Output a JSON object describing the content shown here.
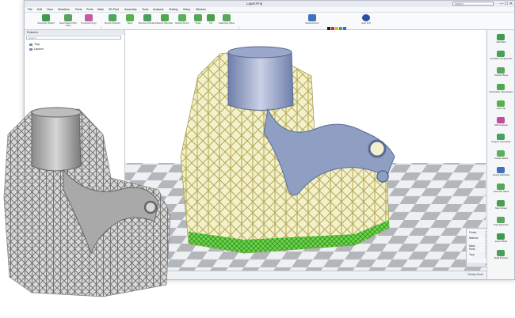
{
  "window": {
    "title": "Layer.Proj",
    "search_placeholder": "Search",
    "controls": "— ☐ ✕"
  },
  "menu": [
    "File",
    "Edit",
    "View",
    "Workflow",
    "Parts",
    "Prefs",
    "Mark",
    "3D Print",
    "Assembly",
    "Tools",
    "Analysis",
    "Testing",
    "Setup",
    "Window"
  ],
  "ribbon": {
    "buttons": [
      {
        "label": "Assembly Wizard"
      },
      {
        "label": "Neat Nested SCC Copy"
      },
      {
        "label": "Unnamed Copy"
      },
      {
        "label": "Round Chamfer"
      },
      {
        "label": "Taper"
      },
      {
        "label": "Remove & Extend"
      },
      {
        "label": "Resize Shoulder"
      },
      {
        "label": "Resize Punch"
      },
      {
        "label": "Scale"
      },
      {
        "label": "Cut"
      },
      {
        "label": "Hollowing Offset"
      },
      {
        "label": "Measurement"
      },
      {
        "label": "Help (F1)"
      }
    ]
  },
  "features_panel": {
    "title": "Features",
    "search_placeholder": "Search",
    "tree": [
      {
        "label": "Tray"
      },
      {
        "label": "Launch"
      }
    ]
  },
  "right_panel": {
    "items": [
      {
        "label": "Add Parts"
      },
      {
        "label": "Add SDF Components"
      },
      {
        "label": "Position Body"
      },
      {
        "label": "Orientation Optimisation"
      },
      {
        "label": "Auto Lab"
      },
      {
        "label": "SDF Analysis"
      },
      {
        "label": "Support Generation"
      },
      {
        "label": "Create Lattice"
      },
      {
        "label": "Accept Wardrobe"
      },
      {
        "label": "Calculate Slices"
      },
      {
        "label": "Slice Viewer"
      },
      {
        "label": "Prep Extension"
      },
      {
        "label": "Export Build"
      },
      {
        "label": "Build Preview"
      }
    ]
  },
  "info_box": {
    "rows": [
      {
        "key": "Printer",
        "value": "EMP 2814 Series"
      },
      {
        "key": "Material",
        "value": "Laser Form Ti Gr5"
      },
      {
        "key": "Mass",
        "value": ""
      },
      {
        "key": "Parts",
        "value": "0.21"
      },
      {
        "key": "Total",
        "value": "18.13"
      }
    ],
    "footer": "Layer.Proj"
  },
  "status": {
    "text": "Ready Done"
  },
  "colors": {
    "part": "#8f9ec3",
    "lattice": "#d9d59a",
    "supports": "#4fc234",
    "floor_dark": "#b3b6ba",
    "floor_light": "#eef0f1",
    "accent": "#2b6fd1"
  }
}
